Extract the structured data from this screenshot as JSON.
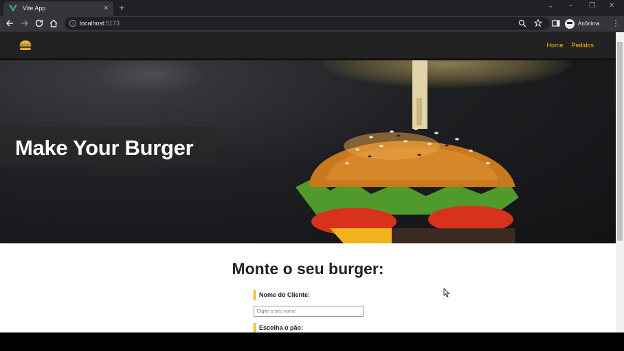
{
  "browser": {
    "tab_title": "Vite App",
    "tab_close": "×",
    "new_tab": "+",
    "url_host": "localhost",
    "url_port": ":5173",
    "profile_name": "Anônima",
    "window_controls": {
      "minimize": "–",
      "maximize": "❐",
      "close": "✕",
      "tab_search": "⌄"
    }
  },
  "nav": {
    "links": [
      "Home",
      "Pedidos"
    ],
    "link_color": "#fcba03"
  },
  "hero": {
    "title": "Make Your Burger"
  },
  "form": {
    "heading": "Monte o seu burger:",
    "name_label": "Nome do Cliente:",
    "name_placeholder": "Digite o seu nome",
    "name_value": "",
    "bread_label": "Escolha o pão:"
  },
  "colors": {
    "accent": "#fcba03",
    "nav_bg": "#222222",
    "browser_bg": "#202124"
  },
  "icons": [
    "vue-logo-icon",
    "back-icon",
    "forward-icon",
    "reload-icon",
    "home-icon",
    "info-icon",
    "zoom-icon",
    "star-icon",
    "side-panel-icon",
    "profile-icon",
    "menu-icon",
    "burger-logo-icon"
  ]
}
